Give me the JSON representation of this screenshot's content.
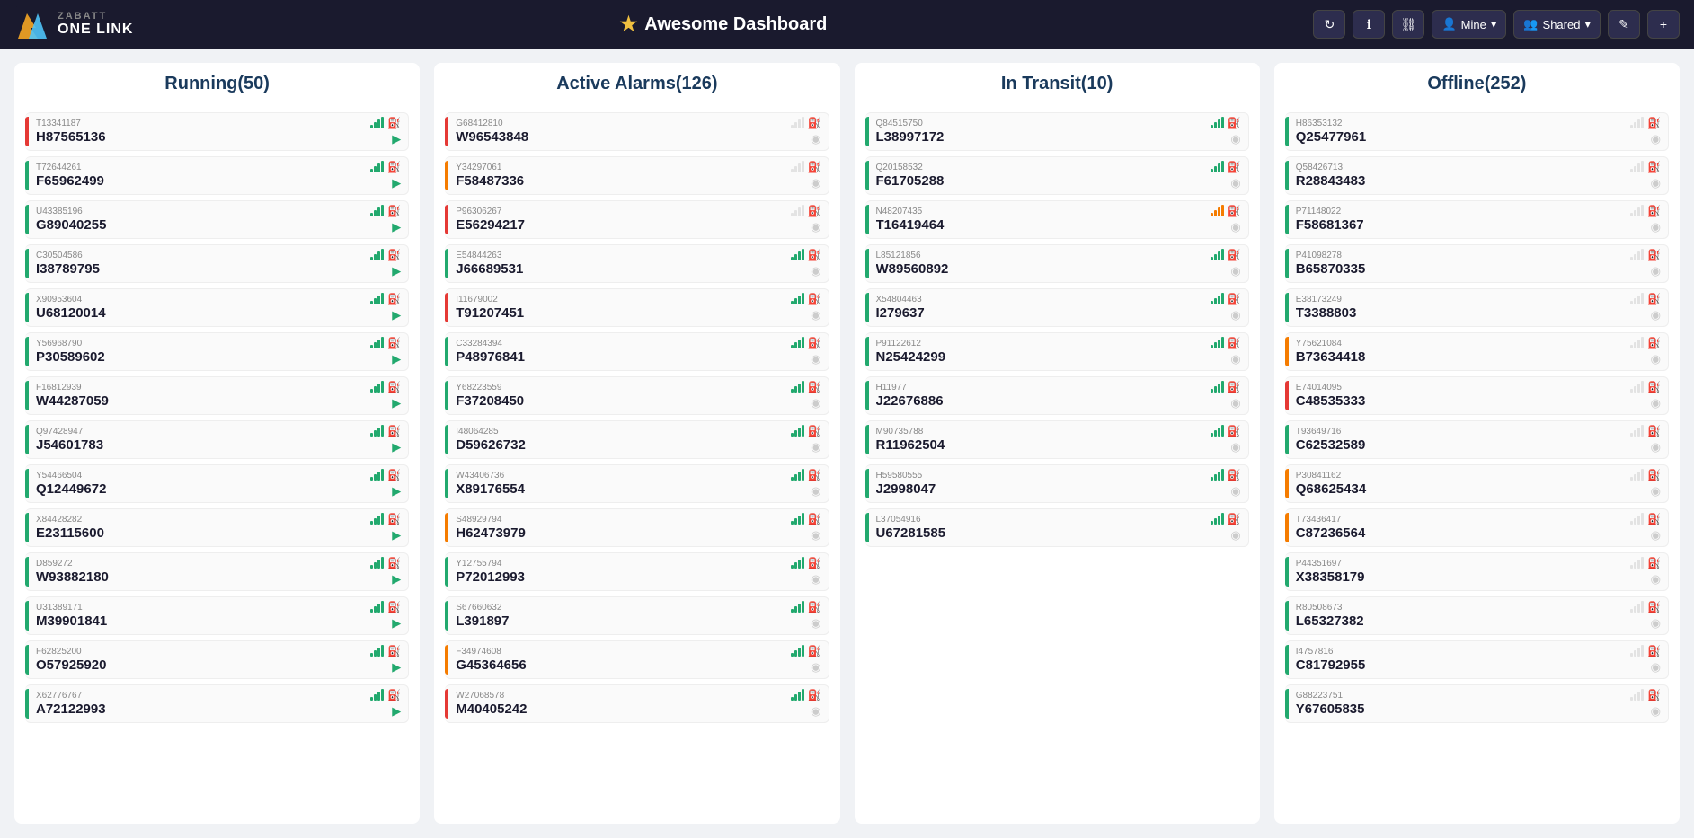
{
  "header": {
    "logo_zabatt": "ZABATT",
    "logo_onelink": "ONE LINK",
    "title": "Awesome Dashboard",
    "star": "★",
    "btn_refresh": "↻",
    "btn_info": "ℹ",
    "btn_link": "⛓",
    "btn_mine": "Mine",
    "btn_shared": "Shared",
    "btn_edit": "✎",
    "btn_add": "+"
  },
  "columns": {
    "running": {
      "title": "Running(50)",
      "items": [
        {
          "id": "T13341187",
          "name": "H87565136",
          "bar": "red",
          "signal": "green",
          "fuel": "orange",
          "action": "play"
        },
        {
          "id": "T72644261",
          "name": "F65962499",
          "bar": "green",
          "signal": "green",
          "fuel": "green",
          "action": "play"
        },
        {
          "id": "U43385196",
          "name": "G89040255",
          "bar": "green",
          "signal": "green",
          "fuel": "green",
          "action": "play"
        },
        {
          "id": "C30504586",
          "name": "I38789795",
          "bar": "green",
          "signal": "green",
          "fuel": "green",
          "action": "play"
        },
        {
          "id": "X90953604",
          "name": "U68120014",
          "bar": "green",
          "signal": "green",
          "fuel": "green",
          "action": "play"
        },
        {
          "id": "Y56968790",
          "name": "P30589602",
          "bar": "green",
          "signal": "green",
          "fuel": "green",
          "action": "play"
        },
        {
          "id": "F16812939",
          "name": "W44287059",
          "bar": "green",
          "signal": "green",
          "fuel": "green",
          "action": "play"
        },
        {
          "id": "Q97428947",
          "name": "J54601783",
          "bar": "green",
          "signal": "green",
          "fuel": "green",
          "action": "play"
        },
        {
          "id": "Y54466504",
          "name": "Q12449672",
          "bar": "green",
          "signal": "green",
          "fuel": "orange",
          "action": "play"
        },
        {
          "id": "X84428282",
          "name": "E23115600",
          "bar": "green",
          "signal": "green",
          "fuel": "green",
          "action": "play"
        },
        {
          "id": "D859272",
          "name": "W93882180",
          "bar": "green",
          "signal": "green",
          "fuel": "green",
          "action": "play"
        },
        {
          "id": "U31389171",
          "name": "M39901841",
          "bar": "green",
          "signal": "green",
          "fuel": "green",
          "action": "play"
        },
        {
          "id": "F62825200",
          "name": "O57925920",
          "bar": "green",
          "signal": "green",
          "fuel": "green",
          "action": "play"
        },
        {
          "id": "X62776767",
          "name": "A72122993",
          "bar": "green",
          "signal": "green",
          "fuel": "orange",
          "action": "play"
        }
      ]
    },
    "alarms": {
      "title": "Active Alarms(126)",
      "items": [
        {
          "id": "G68412810",
          "name": "W96543848",
          "bar": "red",
          "signal": "gray",
          "fuel": "green",
          "action": "circle"
        },
        {
          "id": "Y34297061",
          "name": "F58487336",
          "bar": "orange",
          "signal": "gray",
          "fuel": "green",
          "action": "circle"
        },
        {
          "id": "P96306267",
          "name": "E56294217",
          "bar": "red",
          "signal": "gray",
          "fuel": "gray",
          "action": "circle"
        },
        {
          "id": "E54844263",
          "name": "J66689531",
          "bar": "green",
          "signal": "green",
          "fuel": "green",
          "action": "circle"
        },
        {
          "id": "I11679002",
          "name": "T91207451",
          "bar": "red",
          "signal": "green",
          "fuel": "green",
          "action": "circle"
        },
        {
          "id": "C33284394",
          "name": "P48976841",
          "bar": "green",
          "signal": "green",
          "fuel": "green",
          "action": "circle"
        },
        {
          "id": "Y68223559",
          "name": "F37208450",
          "bar": "green",
          "signal": "green",
          "fuel": "green",
          "action": "circle"
        },
        {
          "id": "I48064285",
          "name": "D59626732",
          "bar": "green",
          "signal": "green",
          "fuel": "green",
          "action": "circle"
        },
        {
          "id": "W43406736",
          "name": "X89176554",
          "bar": "green",
          "signal": "green",
          "fuel": "green",
          "action": "circle"
        },
        {
          "id": "S48929794",
          "name": "H62473979",
          "bar": "orange",
          "signal": "green",
          "fuel": "green",
          "action": "circle"
        },
        {
          "id": "Y12755794",
          "name": "P72012993",
          "bar": "green",
          "signal": "green",
          "fuel": "orange",
          "action": "circle"
        },
        {
          "id": "S67660632",
          "name": "L391897",
          "bar": "green",
          "signal": "green",
          "fuel": "green",
          "action": "circle"
        },
        {
          "id": "F34974608",
          "name": "G45364656",
          "bar": "orange",
          "signal": "green",
          "fuel": "green",
          "action": "circle"
        },
        {
          "id": "W27068578",
          "name": "M40405242",
          "bar": "red",
          "signal": "green",
          "fuel": "green",
          "action": "circle"
        }
      ]
    },
    "transit": {
      "title": "In Transit(10)",
      "items": [
        {
          "id": "Q84515750",
          "name": "L38997172",
          "bar": "green",
          "signal": "green",
          "fuel": "red",
          "action": "circle"
        },
        {
          "id": "Q20158532",
          "name": "F61705288",
          "bar": "green",
          "signal": "green",
          "fuel": "green",
          "action": "circle"
        },
        {
          "id": "N48207435",
          "name": "T16419464",
          "bar": "green",
          "signal": "orange",
          "fuel": "green",
          "action": "circle"
        },
        {
          "id": "L85121856",
          "name": "W89560892",
          "bar": "green",
          "signal": "green",
          "fuel": "green",
          "action": "circle"
        },
        {
          "id": "X54804463",
          "name": "I279637",
          "bar": "green",
          "signal": "green",
          "fuel": "green",
          "action": "circle"
        },
        {
          "id": "P91122612",
          "name": "N25424299",
          "bar": "green",
          "signal": "green",
          "fuel": "green",
          "action": "circle"
        },
        {
          "id": "H11977",
          "name": "J22676886",
          "bar": "green",
          "signal": "green",
          "fuel": "green",
          "action": "circle"
        },
        {
          "id": "M90735788",
          "name": "R11962504",
          "bar": "green",
          "signal": "green",
          "fuel": "green",
          "action": "circle"
        },
        {
          "id": "H59580555",
          "name": "J2998047",
          "bar": "green",
          "signal": "green",
          "fuel": "green",
          "action": "circle"
        },
        {
          "id": "L37054916",
          "name": "U67281585",
          "bar": "green",
          "signal": "green",
          "fuel": "green",
          "action": "circle"
        }
      ]
    },
    "offline": {
      "title": "Offline(252)",
      "items": [
        {
          "id": "H86353132",
          "name": "Q25477961",
          "bar": "green",
          "signal": "gray",
          "fuel": "green",
          "action": "circle"
        },
        {
          "id": "Q58426713",
          "name": "R28843483",
          "bar": "green",
          "signal": "gray",
          "fuel": "orange",
          "action": "circle"
        },
        {
          "id": "P71148022",
          "name": "F58681367",
          "bar": "green",
          "signal": "gray",
          "fuel": "green",
          "action": "circle"
        },
        {
          "id": "P41098278",
          "name": "B65870335",
          "bar": "green",
          "signal": "gray",
          "fuel": "green",
          "action": "circle"
        },
        {
          "id": "E38173249",
          "name": "T3388803",
          "bar": "green",
          "signal": "gray",
          "fuel": "green",
          "action": "circle"
        },
        {
          "id": "Y75621084",
          "name": "B73634418",
          "bar": "orange",
          "signal": "gray",
          "fuel": "red",
          "action": "circle"
        },
        {
          "id": "E74014095",
          "name": "C48535333",
          "bar": "red",
          "signal": "gray",
          "fuel": "orange",
          "action": "circle"
        },
        {
          "id": "T93649716",
          "name": "C62532589",
          "bar": "green",
          "signal": "gray",
          "fuel": "red",
          "action": "circle"
        },
        {
          "id": "P30841162",
          "name": "Q68625434",
          "bar": "orange",
          "signal": "gray",
          "fuel": "red",
          "action": "circle"
        },
        {
          "id": "T73436417",
          "name": "C87236564",
          "bar": "orange",
          "signal": "gray",
          "fuel": "green",
          "action": "circle"
        },
        {
          "id": "P44351697",
          "name": "X38358179",
          "bar": "green",
          "signal": "gray",
          "fuel": "green",
          "action": "circle"
        },
        {
          "id": "R80508673",
          "name": "L65327382",
          "bar": "green",
          "signal": "gray",
          "fuel": "orange",
          "action": "circle"
        },
        {
          "id": "I4757816",
          "name": "C81792955",
          "bar": "green",
          "signal": "gray",
          "fuel": "green",
          "action": "circle"
        },
        {
          "id": "G88223751",
          "name": "Y67605835",
          "bar": "green",
          "signal": "gray",
          "fuel": "green",
          "action": "circle"
        }
      ]
    }
  }
}
